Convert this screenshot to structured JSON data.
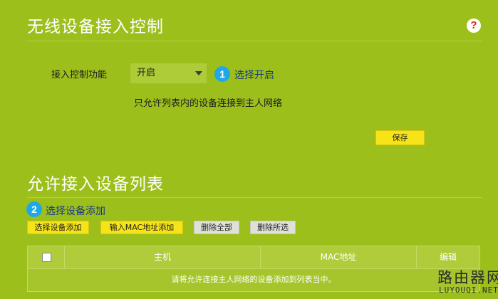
{
  "access_control": {
    "title": "无线设备接入控制",
    "help_icon_text": "?",
    "function_label": "接入控制功能",
    "select_value": "开启",
    "step1_number": "1",
    "step1_hint": "选择开启",
    "description": "只允许列表内的设备连接到主人网络",
    "save_label": "保存"
  },
  "device_list": {
    "title": "允许接入设备列表",
    "step2_number": "2",
    "step2_hint": "选择设备添加",
    "buttons": {
      "select_device": "选择设备添加",
      "input_mac": "输入MAC地址添加",
      "delete_all": "删除全部",
      "delete_selected": "删除所选"
    },
    "table": {
      "columns": [
        "主机",
        "MAC地址",
        "编辑"
      ],
      "empty_text": "请将允许连接主人网络的设备添加到列表当中。"
    }
  },
  "watermark": {
    "cn": "路由器网",
    "en": "LUYOUQI.NET"
  },
  "colors": {
    "background": "#9dbf1c",
    "button_primary": "#f6e318",
    "button_secondary": "#dfe0d8",
    "badge": "#1ea8e6",
    "hint_text": "#1a3a86",
    "help_icon": "#d8261b"
  },
  "icons": {
    "help": "question-mark-icon",
    "dropdown": "caret-down-icon"
  }
}
